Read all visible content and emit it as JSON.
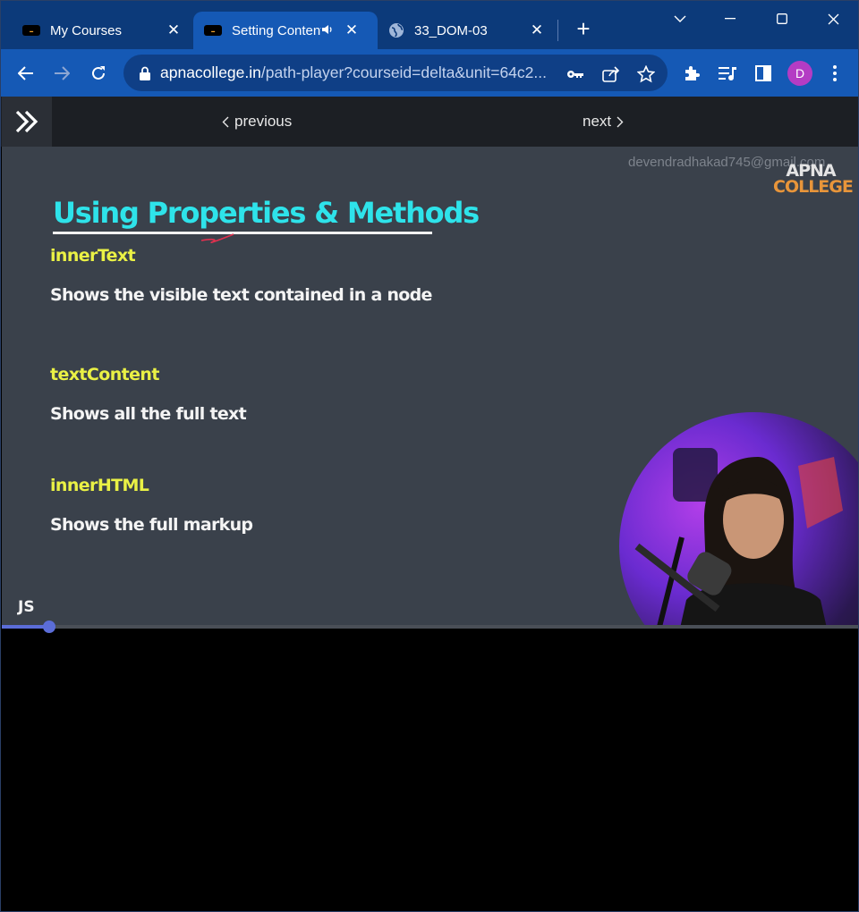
{
  "browser": {
    "tabs": [
      {
        "label": "My Courses",
        "favicon": "apna-college-favicon",
        "active": false
      },
      {
        "label": "Setting Content",
        "favicon": "apna-college-favicon",
        "active": true,
        "audio": true
      },
      {
        "label": "33_DOM-03",
        "favicon": "globe-icon",
        "active": false
      }
    ],
    "url": {
      "host": "apnacollege.in",
      "path": "/path-player?courseid=delta&unit=64c2..."
    },
    "profile_initial": "D"
  },
  "player": {
    "previous_label": "previous",
    "next_label": "next"
  },
  "slide": {
    "watermark": "devendradhakad745@gmail.com",
    "brand_line1": "APNA",
    "brand_line2": "COLLEGE",
    "title": "Using Properties & Methods",
    "items": [
      {
        "term": "innerText",
        "desc": "Shows the visible text contained in a node"
      },
      {
        "term": "textContent",
        "desc": "Shows all the full text"
      },
      {
        "term": "innerHTML",
        "desc": "Shows the full markup"
      }
    ],
    "corner_tag": "JS"
  },
  "progress": {
    "fraction": 0.055
  },
  "colors": {
    "tabstrip": "#0c3a7a",
    "toolbar": "#1559b5",
    "slide_bg": "#3a414b",
    "title": "#2ee3ea",
    "term": "#eaf145",
    "progress": "#5b6dd8"
  }
}
